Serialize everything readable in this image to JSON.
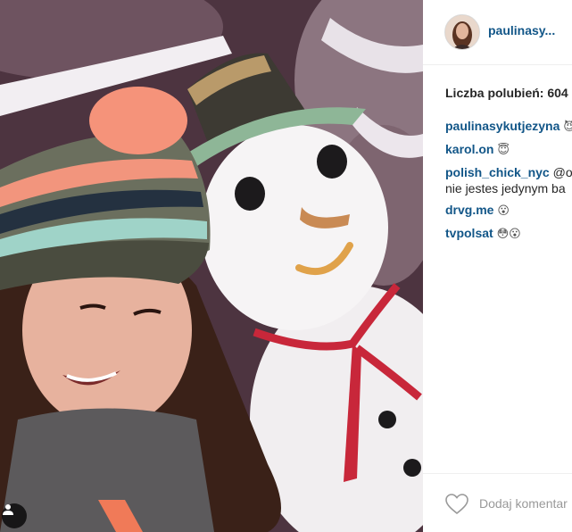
{
  "post": {
    "username": "paulinasy...",
    "likes_text": "Liczba polubień: 604",
    "comments": [
      {
        "author": "paulinasykutjezyna",
        "text": "",
        "emoji": "😈"
      },
      {
        "author": "karol.on",
        "text": "",
        "emoji": "😇"
      },
      {
        "author": "polish_chick_nyc",
        "text": "@ol",
        "continuation": "nie jestes jedynym ba",
        "emoji": ""
      },
      {
        "author": "drvg.me",
        "text": "",
        "emoji": "😮"
      },
      {
        "author": "tvpolsat",
        "text": "",
        "emoji": "😳😮"
      }
    ],
    "add_comment_placeholder": "Dodaj komentar"
  },
  "photo": {
    "alt_subject": "selfie with snowman"
  },
  "icons": {
    "like": "heart-icon",
    "user_tag": "user-tag-icon"
  },
  "colors": {
    "username_link": "#125688",
    "text": "#262626",
    "placeholder": "#999999",
    "divider": "#efefef"
  }
}
